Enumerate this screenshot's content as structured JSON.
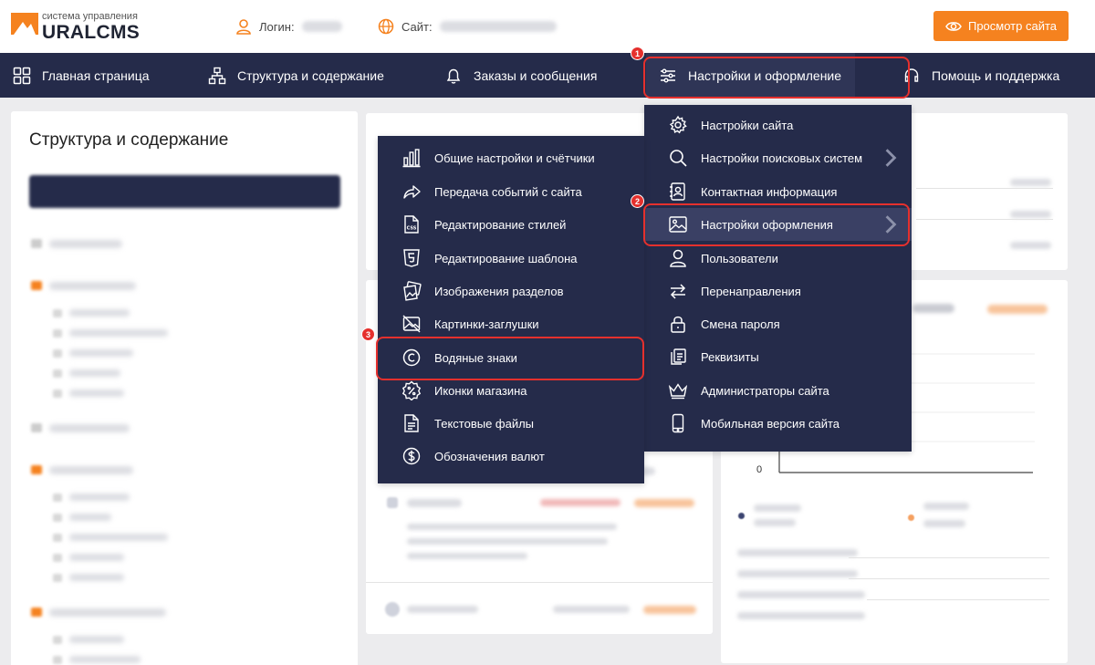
{
  "header": {
    "logo_subtitle": "система управления",
    "logo_name": "URALCMS",
    "login_label": "Логин:",
    "site_label": "Сайт:",
    "view_site_button": "Просмотр сайта"
  },
  "nav": {
    "items": [
      {
        "label": "Главная страница",
        "icon": "grid-icon"
      },
      {
        "label": "Структура и содержание",
        "icon": "sitemap-icon"
      },
      {
        "label": "Заказы и сообщения",
        "icon": "bell-icon"
      },
      {
        "label": "Настройки и оформление",
        "icon": "sliders-icon"
      },
      {
        "label": "Помощь и поддержка",
        "icon": "headset-icon"
      }
    ]
  },
  "sidebar": {
    "title": "Структура и содержание"
  },
  "background_chart": {
    "axis_zero": "0"
  },
  "settings_menu": {
    "items": [
      {
        "label": "Настройки сайта",
        "icon": "gear-icon"
      },
      {
        "label": "Настройки поисковых систем",
        "icon": "search-icon",
        "has_submenu": true
      },
      {
        "label": "Контактная информация",
        "icon": "contact-card-icon"
      },
      {
        "label": "Настройки оформления",
        "icon": "image-icon",
        "has_submenu": true
      },
      {
        "label": "Пользователи",
        "icon": "user-icon"
      },
      {
        "label": "Перенаправления",
        "icon": "redirect-arrows-icon"
      },
      {
        "label": "Смена пароля",
        "icon": "lock-icon"
      },
      {
        "label": "Реквизиты",
        "icon": "copy-docs-icon"
      },
      {
        "label": "Администраторы сайта",
        "icon": "crown-icon"
      },
      {
        "label": "Мобильная версия сайта",
        "icon": "mobile-icon"
      }
    ]
  },
  "design_submenu": {
    "items": [
      {
        "label": "Общие настройки и счётчики",
        "icon": "bar-chart-icon"
      },
      {
        "label": "Передача событий с сайта",
        "icon": "share-arrow-icon"
      },
      {
        "label": "Редактирование стилей",
        "icon": "css-file-icon"
      },
      {
        "label": "Редактирование шаблона",
        "icon": "html5-icon"
      },
      {
        "label": "Изображения разделов",
        "icon": "images-icon"
      },
      {
        "label": "Картинки-заглушки",
        "icon": "image-off-icon"
      },
      {
        "label": "Водяные знаки",
        "icon": "copyright-icon"
      },
      {
        "label": "Иконки магазина",
        "icon": "percent-badge-icon"
      },
      {
        "label": "Текстовые файлы",
        "icon": "text-file-icon"
      },
      {
        "label": "Обозначения валют",
        "icon": "dollar-coin-icon"
      }
    ]
  },
  "step_badges": [
    "1",
    "2",
    "3"
  ],
  "colors": {
    "nav_bg": "#252b4a",
    "accent": "#f5821f",
    "highlight": "#e5302d"
  }
}
